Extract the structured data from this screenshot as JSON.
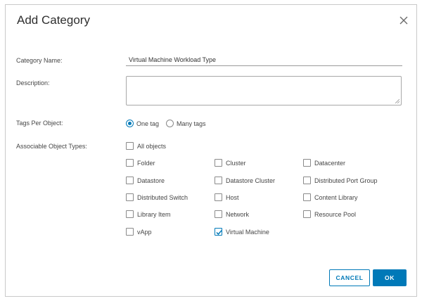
{
  "dialog": {
    "title": "Add Category",
    "close_icon": "close-icon"
  },
  "form": {
    "category_name_label": "Category Name:",
    "category_name_value": "Virtual Machine Workload Type",
    "description_label": "Description:",
    "description_value": "",
    "tags_label": "Tags Per Object:",
    "tags_options": [
      {
        "label": "One tag",
        "selected": true
      },
      {
        "label": "Many tags",
        "selected": false
      }
    ],
    "types_label": "Associable Object Types:",
    "all_objects": {
      "label": "All objects",
      "checked": false
    },
    "object_types": [
      {
        "label": "Folder",
        "checked": false
      },
      {
        "label": "Cluster",
        "checked": false
      },
      {
        "label": "Datacenter",
        "checked": false
      },
      {
        "label": "Datastore",
        "checked": false
      },
      {
        "label": "Datastore Cluster",
        "checked": false
      },
      {
        "label": "Distributed Port Group",
        "checked": false
      },
      {
        "label": "Distributed Switch",
        "checked": false
      },
      {
        "label": "Host",
        "checked": false
      },
      {
        "label": "Content Library",
        "checked": false
      },
      {
        "label": "Library Item",
        "checked": false
      },
      {
        "label": "Network",
        "checked": false
      },
      {
        "label": "Resource Pool",
        "checked": false
      },
      {
        "label": "vApp",
        "checked": false
      },
      {
        "label": "Virtual Machine",
        "checked": true
      }
    ]
  },
  "buttons": {
    "cancel": "CANCEL",
    "ok": "OK"
  },
  "colors": {
    "accent": "#0079b8",
    "border": "#c9c9c9"
  }
}
